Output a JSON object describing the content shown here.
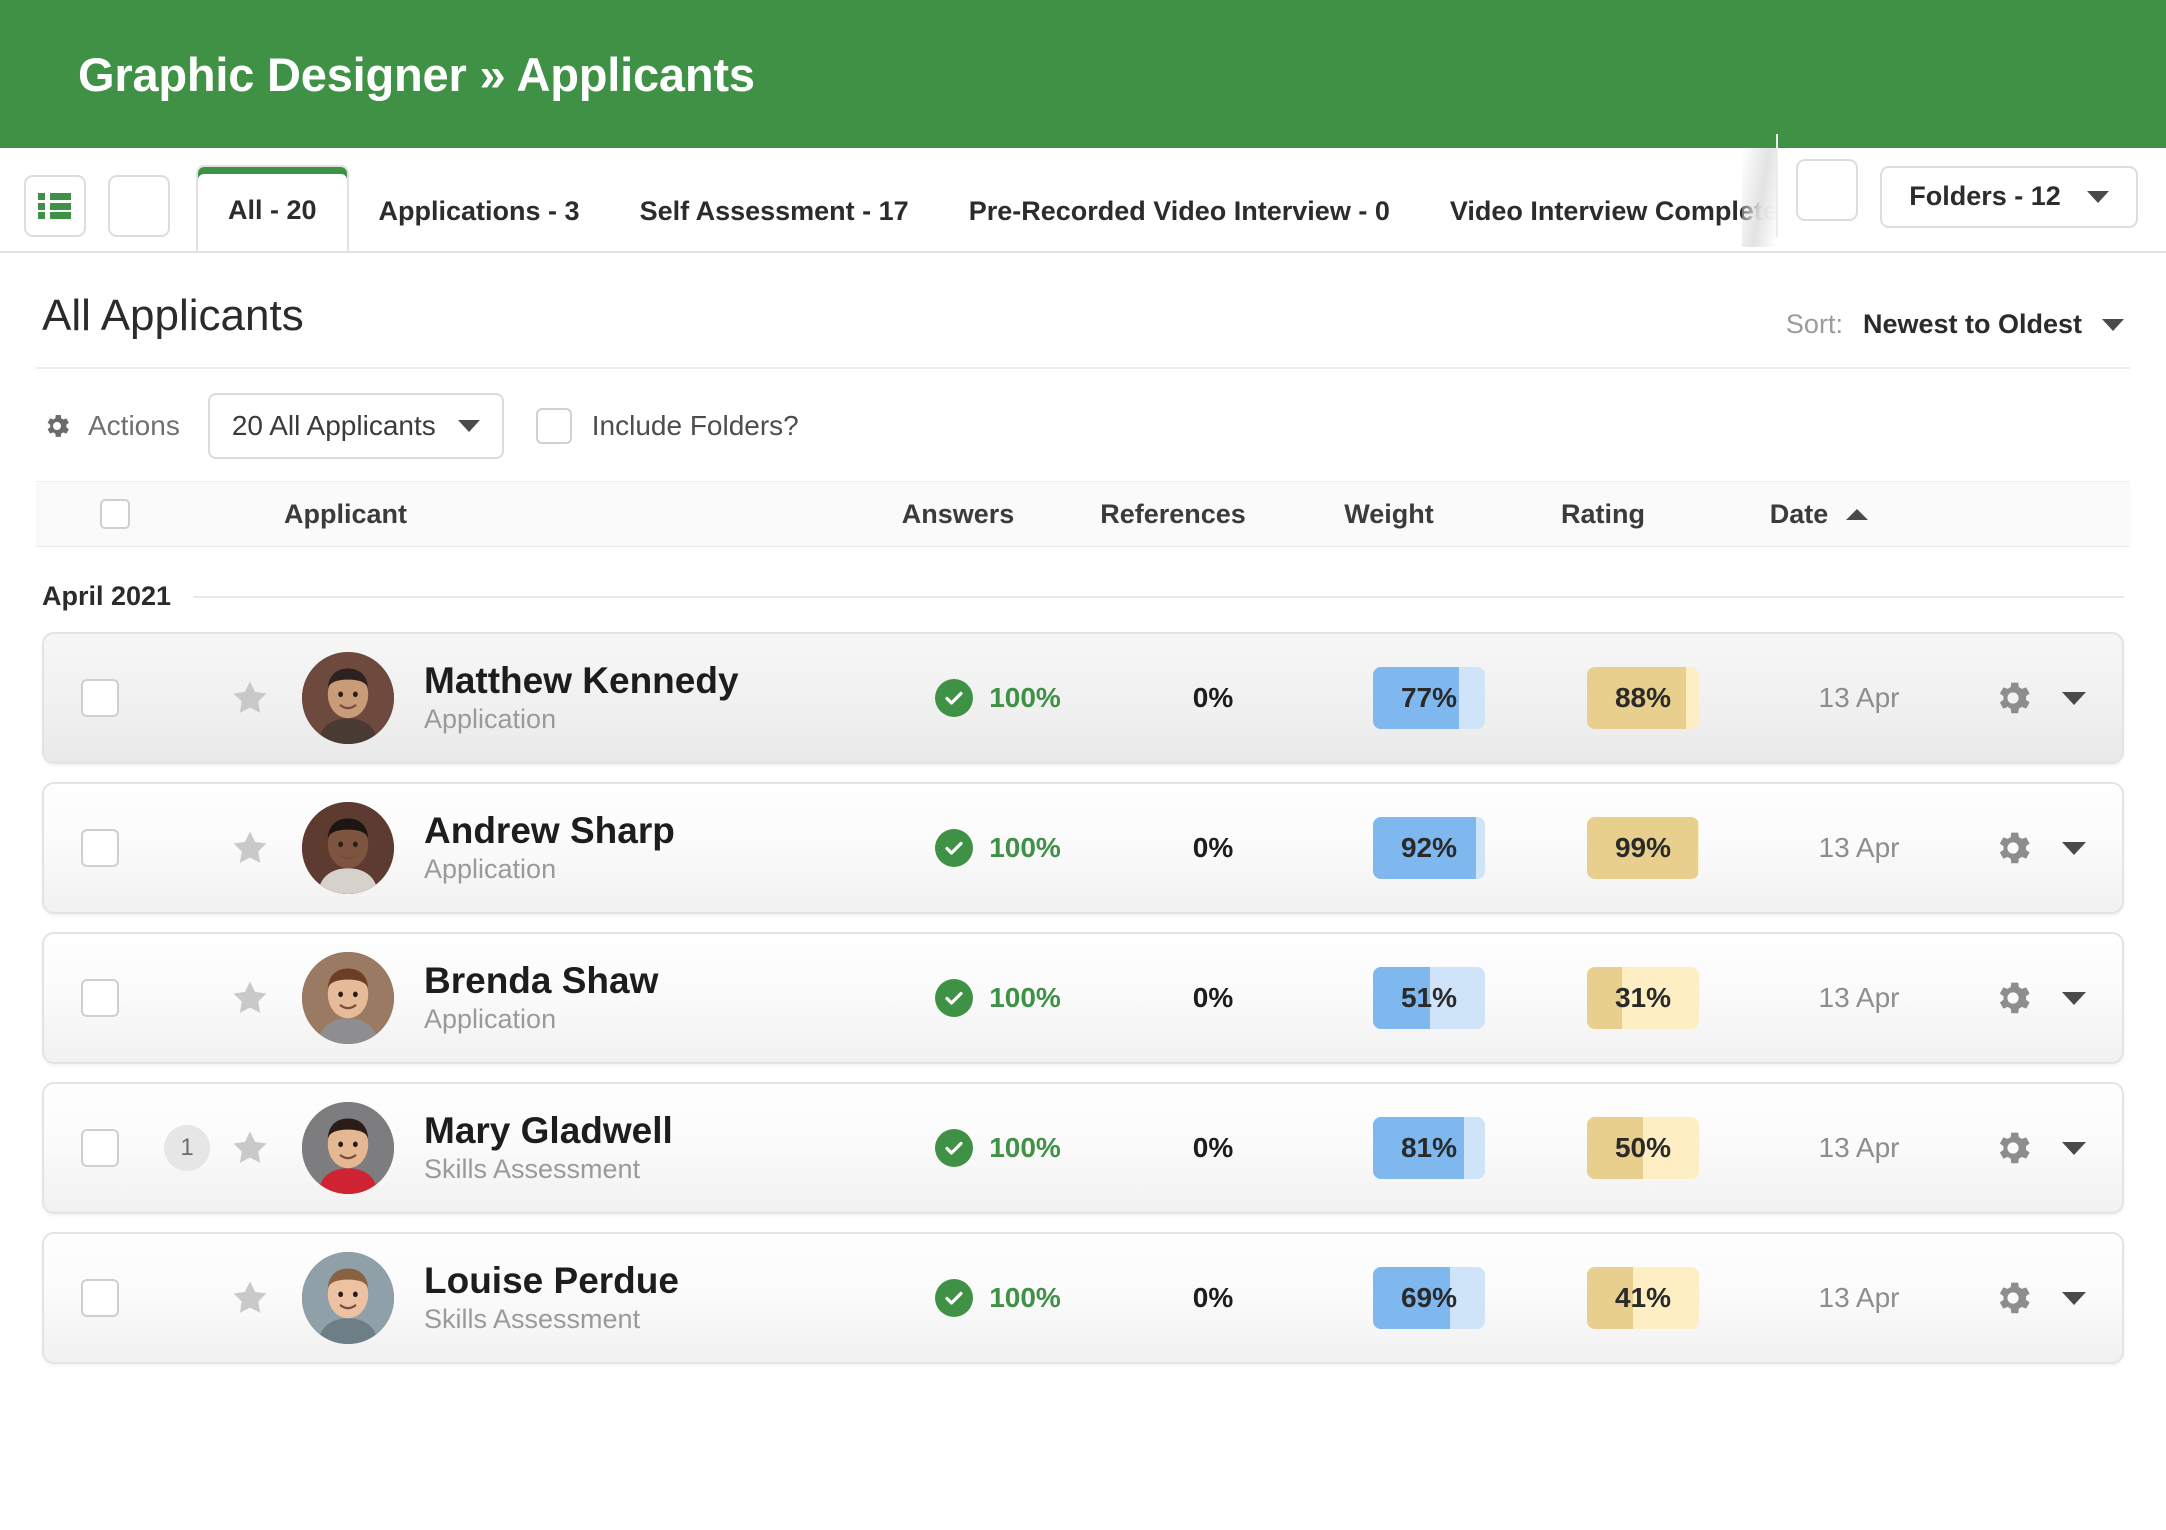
{
  "header": {
    "title": "Graphic Designer » Applicants"
  },
  "tabbar": {
    "list_view_icon": "list-icon",
    "blank_button": "",
    "tabs": [
      {
        "label": "All - 20",
        "active": true
      },
      {
        "label": "Applications - 3",
        "active": false
      },
      {
        "label": "Self Assessment - 17",
        "active": false
      },
      {
        "label": "Pre-Recorded Video Interview - 0",
        "active": false
      },
      {
        "label": "Video Interview Complete",
        "active": false
      }
    ],
    "folders_label": "Folders - 12"
  },
  "page": {
    "title": "All Applicants",
    "sort_label": "Sort:",
    "sort_value": "Newest to Oldest"
  },
  "toolbar": {
    "actions_label": "Actions",
    "scope_select": "20 All Applicants",
    "include_folders_label": "Include Folders?"
  },
  "table": {
    "columns": {
      "applicant": "Applicant",
      "answers": "Answers",
      "references": "References",
      "weight": "Weight",
      "rating": "Rating",
      "date": "Date"
    },
    "date_sort_direction": "asc",
    "month_group": "April 2021",
    "rows": [
      {
        "name": "Matthew Kennedy",
        "stage": "Application",
        "answers": "100%",
        "references": "0%",
        "weight": "77%",
        "weight_pct": 77,
        "rating": "88%",
        "rating_pct": 88,
        "date": "13 Apr",
        "badge": null,
        "avatar_colors": {
          "bg": "#6e4a3e",
          "skin": "#c99b78",
          "hair": "#2e2220",
          "shirt": "#4a3a34"
        },
        "selected": true
      },
      {
        "name": "Andrew Sharp",
        "stage": "Application",
        "answers": "100%",
        "references": "0%",
        "weight": "92%",
        "weight_pct": 92,
        "rating": "99%",
        "rating_pct": 99,
        "date": "13 Apr",
        "badge": null,
        "avatar_colors": {
          "bg": "#5e3b31",
          "skin": "#7d5440",
          "hair": "#1d1512",
          "shirt": "#d6d2cb"
        },
        "selected": false
      },
      {
        "name": "Brenda Shaw",
        "stage": "Application",
        "answers": "100%",
        "references": "0%",
        "weight": "51%",
        "weight_pct": 51,
        "rating": "31%",
        "rating_pct": 31,
        "date": "13 Apr",
        "badge": null,
        "avatar_colors": {
          "bg": "#9a7a63",
          "skin": "#e6bb9a",
          "hair": "#6b3f25",
          "shirt": "#8e8e90"
        },
        "selected": false
      },
      {
        "name": "Mary Gladwell",
        "stage": "Skills Assessment",
        "answers": "100%",
        "references": "0%",
        "weight": "81%",
        "weight_pct": 81,
        "rating": "50%",
        "rating_pct": 50,
        "date": "13 Apr",
        "badge": "1",
        "avatar_colors": {
          "bg": "#7d7d80",
          "skin": "#e3b892",
          "hair": "#2a1c16",
          "shirt": "#cf2233"
        },
        "selected": false
      },
      {
        "name": "Louise Perdue",
        "stage": "Skills Assessment",
        "answers": "100%",
        "references": "0%",
        "weight": "69%",
        "weight_pct": 69,
        "rating": "41%",
        "rating_pct": 41,
        "date": "13 Apr",
        "badge": null,
        "avatar_colors": {
          "bg": "#8fa0a8",
          "skin": "#edc2a3",
          "hair": "#8a6240",
          "shirt": "#6e7e86"
        },
        "selected": false
      }
    ]
  },
  "colors": {
    "brand_green": "#3f9145",
    "weight_fill": "#7fb8ee",
    "weight_track": "#cfe4f9",
    "rating_fill": "#e8cf8d",
    "rating_track": "#fdeec4"
  }
}
